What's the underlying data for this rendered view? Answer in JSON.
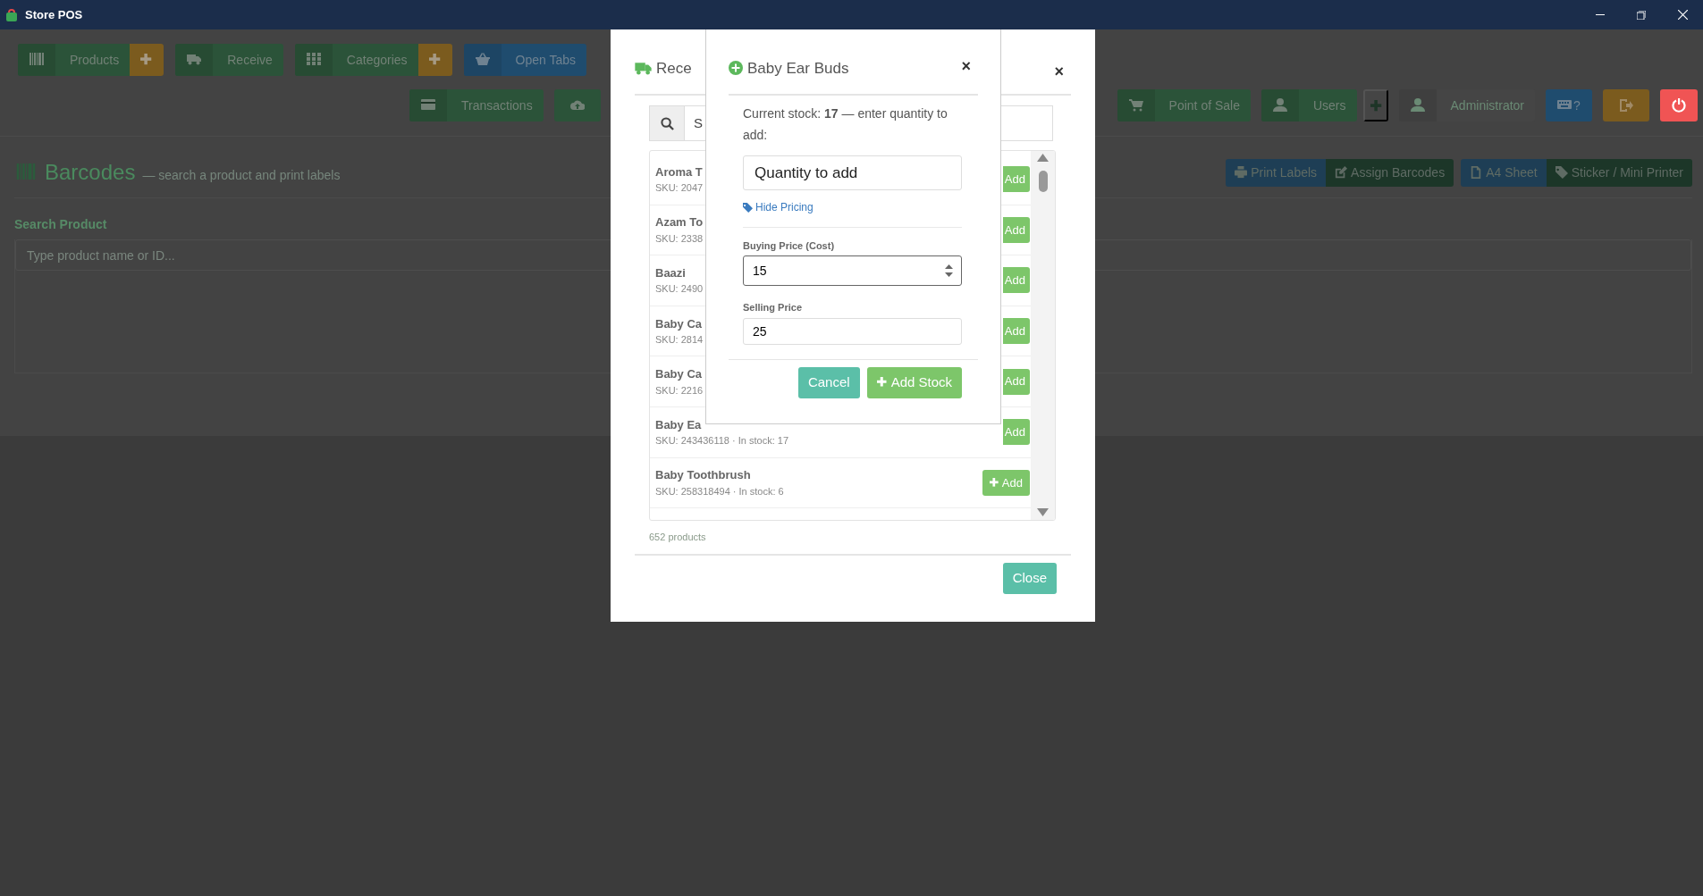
{
  "window": {
    "title": "Store POS"
  },
  "toolbar": {
    "row_1": [
      {
        "label": "Products",
        "kind": "green",
        "add": true
      },
      {
        "label": "Receive",
        "kind": "green",
        "add": false
      },
      {
        "label": "Categories",
        "kind": "green",
        "add": true
      },
      {
        "label": "Open Tabs",
        "kind": "blue",
        "add": false
      }
    ],
    "row_2_left": [
      {
        "label": "Transactions",
        "kind": "green",
        "add": false
      },
      {
        "kind": "green",
        "add": false
      }
    ],
    "row_2_right": [
      {
        "label": "Point of Sale",
        "kind": "green",
        "add": false
      },
      {
        "label": "Users",
        "kind": "green",
        "add": true
      },
      {
        "label": "Administrator",
        "kind": "plain",
        "add": false
      },
      {
        "label": "?",
        "kind": "blue",
        "add": false
      },
      {
        "kind": "orange",
        "add": false
      },
      {
        "kind": "red",
        "add": false
      }
    ]
  },
  "page": {
    "title": "Barcodes",
    "subtitle": "— search a product and print labels",
    "button_groups": [
      [
        {
          "label": "Print Labels",
          "kind": "blue"
        },
        {
          "label": "Assign Barcodes",
          "kind": "green"
        }
      ],
      [
        {
          "label": "A4 Sheet",
          "kind": "blue"
        },
        {
          "label": "Sticker / Mini Printer",
          "kind": "green"
        }
      ]
    ],
    "search": {
      "label": "Search Product",
      "placeholder": "Type product name or ID..."
    }
  },
  "receive_dialog": {
    "title": "Rece",
    "close_icon": "×",
    "search": {
      "placeholder": "S"
    },
    "products": [
      {
        "name": "Aroma T",
        "sku": "SKU: 2047",
        "button": "Add",
        "plus_icon": false
      },
      {
        "name": "Azam To",
        "sku": "SKU: 2338",
        "button": "Add",
        "plus_icon": false
      },
      {
        "name": "Baazi",
        "sku": "SKU: 2490",
        "button": "Add",
        "plus_icon": false
      },
      {
        "name": "Baby Ca",
        "sku": "SKU: 2814",
        "button": "Add",
        "plus_icon": false
      },
      {
        "name": "Baby Ca",
        "sku": "SKU: 2216",
        "button": "Add",
        "plus_icon": false
      },
      {
        "name": "Baby Ea",
        "sku": "SKU: 243436118 · In stock: 17",
        "button": "Add",
        "plus_icon": false
      },
      {
        "name": "Baby Toothbrush",
        "sku": "SKU: 258318494 · In stock: 6",
        "button": "Add",
        "plus_icon": true
      }
    ],
    "count": "652 products",
    "close": "Close"
  },
  "add_stock_dialog": {
    "title": "Baby Ear Buds",
    "close_icon": "×",
    "message": "Current stock: **17** — enter quantity to add:",
    "quantity": {
      "placeholder": "Quantity to add"
    },
    "pricing_link": "Hide Pricing",
    "buying_price": {
      "label": "Buying Price (Cost)",
      "value": "15"
    },
    "selling_price": {
      "label": "Selling Price",
      "value": "25"
    },
    "cancel": "Cancel",
    "submit": "Add Stock"
  }
}
